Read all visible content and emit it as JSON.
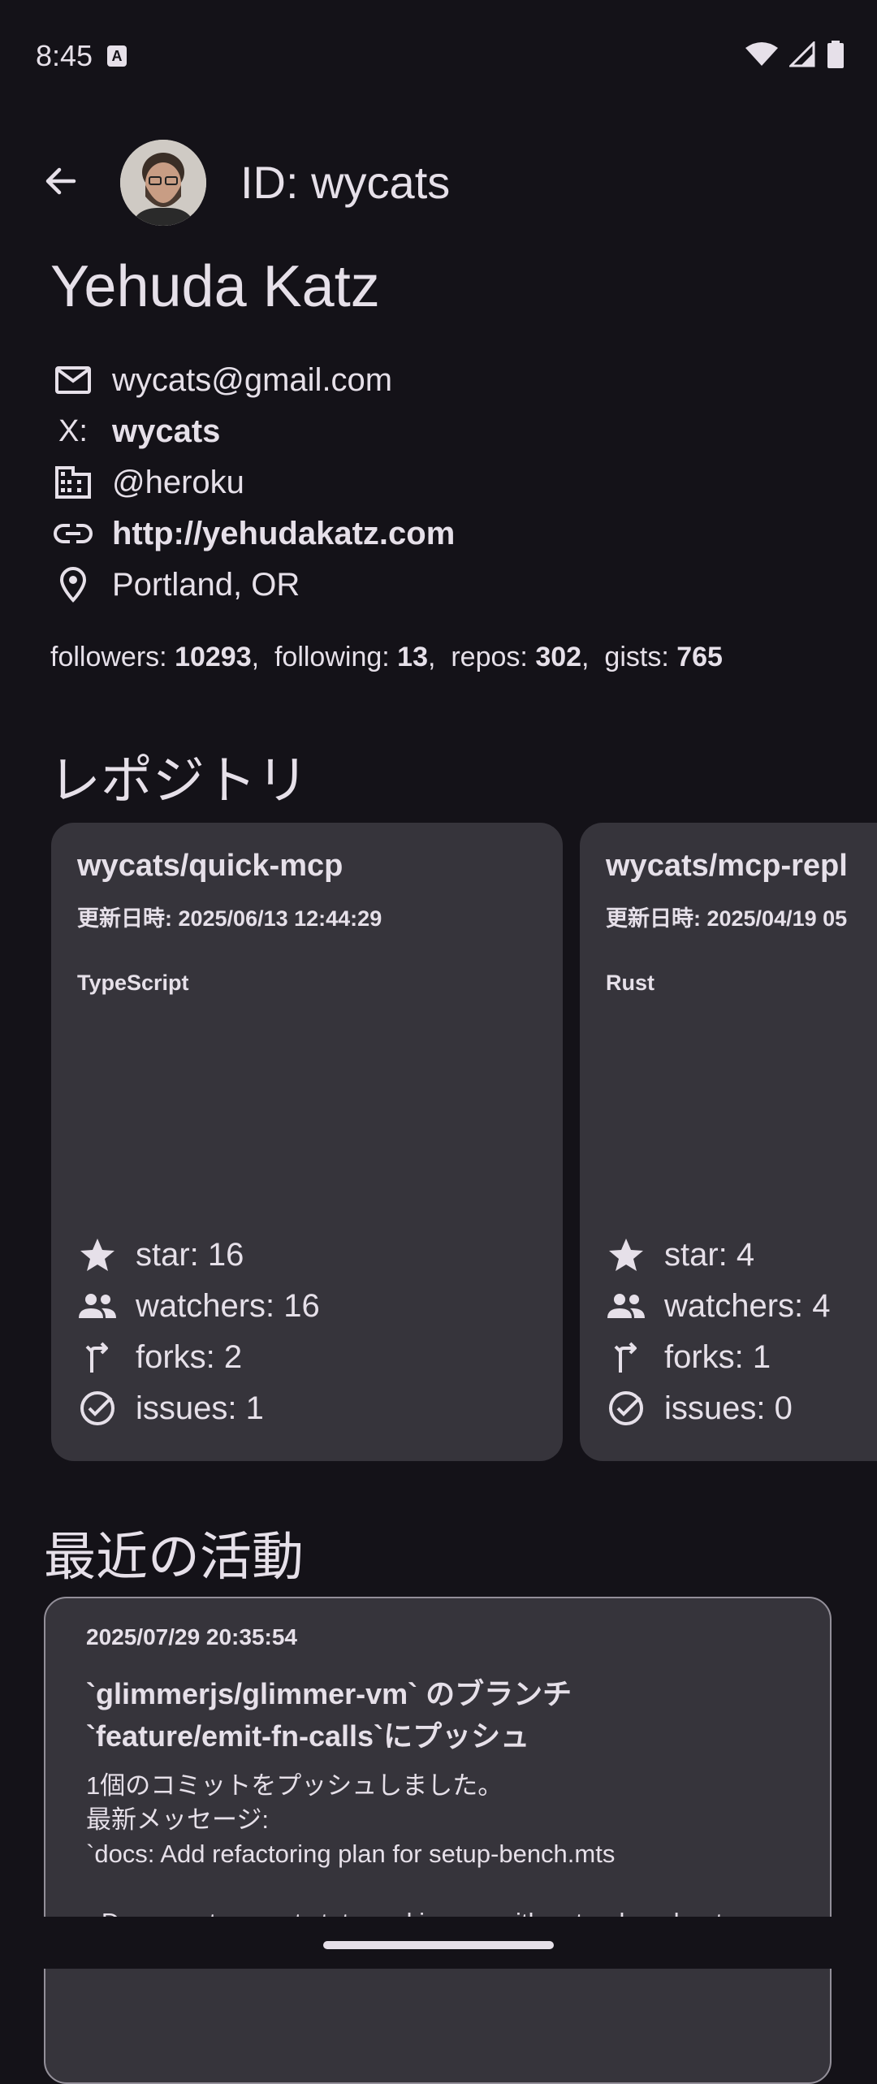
{
  "status_bar": {
    "time": "8:45",
    "keyboard_badge": "A"
  },
  "header": {
    "id_label": "ID: wycats"
  },
  "profile": {
    "name": "Yehuda Katz",
    "email": "wycats@gmail.com",
    "x_label": "X:",
    "x_handle": "wycats",
    "company": "@heroku",
    "blog": "http://yehudakatz.com",
    "location": "Portland, OR"
  },
  "stats": {
    "followers_label": "followers: ",
    "followers": "10293",
    "following_label": "following: ",
    "following": "13",
    "repos_label": "repos: ",
    "repos": "302",
    "gists_label": "gists: ",
    "gists": "765",
    "sep": ","
  },
  "repos_section_title": "レポジトリ",
  "repos": [
    {
      "name": "wycats/quick-mcp",
      "updated": "更新日時: 2025/06/13 12:44:29",
      "language": "TypeScript",
      "star": "star: 16",
      "watchers": "watchers: 16",
      "forks": "forks: 2",
      "issues": "issues: 1"
    },
    {
      "name": "wycats/mcp-repl",
      "updated": "更新日時: 2025/04/19 05",
      "language": "Rust",
      "star": "star: 4",
      "watchers": "watchers: 4",
      "forks": "forks: 1",
      "issues": "issues: 0"
    }
  ],
  "activity_section_title": "最近の活動",
  "activity": {
    "date": "2025/07/29 20:35:54",
    "title": "`glimmerjs/glimmer-vm` のブランチ`feature/emit-fn-calls`にプッシュ",
    "body": "1個のコミットをプッシュしました。\n最新メッセージ:\n`docs: Add refactoring plan for setup-bench.mts\n\n- Document current state and issues with setup-bench.mt"
  },
  "icons": {
    "back": "arrow-back-icon",
    "email": "mail-icon",
    "company": "building-icon",
    "link": "link-icon",
    "location": "location-pin-icon",
    "star": "star-icon",
    "watchers": "people-icon",
    "forks": "fork-icon",
    "issues": "check-circle-icon"
  }
}
